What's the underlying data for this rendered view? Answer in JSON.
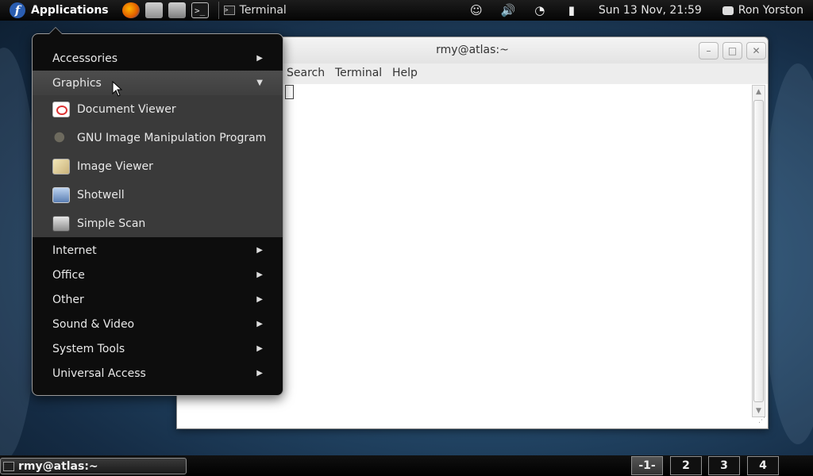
{
  "top_panel": {
    "applications_label": "Applications",
    "fedora_logo_glyph": "f",
    "launchers": [
      "firefox-icon",
      "mail-clock-icon",
      "file-manager-icon",
      "terminal-icon"
    ],
    "active_window_label": "Terminal",
    "clock": "Sun 13 Nov, 21:59",
    "user_name": "Ron Yorston",
    "tray": [
      "accessibility-icon",
      "volume-icon",
      "wifi-icon",
      "battery-icon"
    ]
  },
  "terminal_window": {
    "title": "rmy@atlas:~",
    "menus": [
      "Search",
      "Terminal",
      "Help"
    ],
    "buttons": {
      "minimize": "–",
      "maximize": "□",
      "close": "✕"
    }
  },
  "apps_menu": {
    "categories": [
      {
        "label": "Accessories",
        "arrow": "▶"
      },
      {
        "label": "Graphics",
        "arrow": "▼"
      },
      {
        "label": "Internet",
        "arrow": "▶"
      },
      {
        "label": "Office",
        "arrow": "▶"
      },
      {
        "label": "Other",
        "arrow": "▶"
      },
      {
        "label": "Sound & Video",
        "arrow": "▶"
      },
      {
        "label": "System Tools",
        "arrow": "▶"
      },
      {
        "label": "Universal Access",
        "arrow": "▶"
      }
    ],
    "graphics_apps": [
      {
        "label": "Document Viewer",
        "icon": "document-viewer-icon"
      },
      {
        "label": "GNU Image Manipulation Program",
        "icon": "gimp-icon"
      },
      {
        "label": "Image Viewer",
        "icon": "image-viewer-icon"
      },
      {
        "label": "Shotwell",
        "icon": "shotwell-icon"
      },
      {
        "label": "Simple Scan",
        "icon": "simple-scan-icon"
      }
    ]
  },
  "bottom_panel": {
    "task_label": "rmy@atlas:~",
    "workspaces": [
      "-1-",
      "2",
      "3",
      "4"
    ]
  }
}
